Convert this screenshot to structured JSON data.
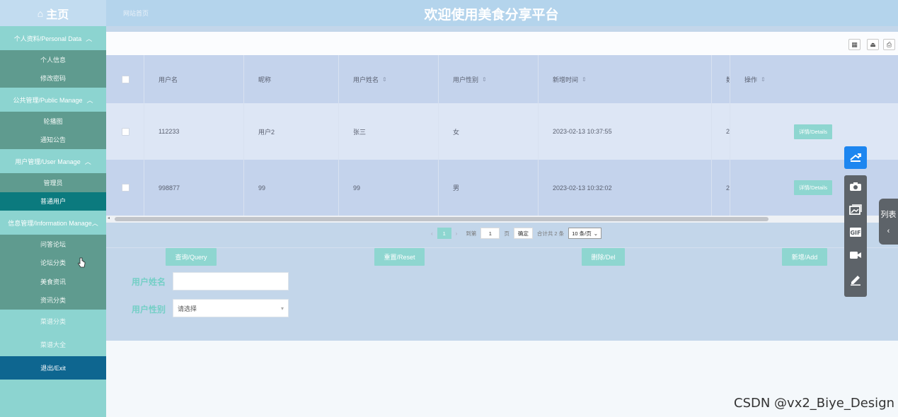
{
  "topbar": {
    "home_icon": "⌂",
    "home_label": "主页",
    "site_link": "网站首页",
    "title": "欢迎使用美食分享平台"
  },
  "sidebar": {
    "groups": [
      {
        "title": "个人资料/Personal Data",
        "items": [
          "个人信息",
          "修改密码"
        ]
      },
      {
        "title": "公共管理/Public Manage",
        "items": [
          "轮播图",
          "通知公告"
        ]
      },
      {
        "title": "用户管理/User Manage",
        "items": [
          "管理员",
          "普通用户"
        ]
      },
      {
        "title": "信息管理/Information Manage",
        "items": [
          "问答论坛",
          "论坛分类",
          "美食资讯",
          "资讯分类"
        ]
      }
    ],
    "singles": [
      "菜谱分类",
      "菜谱大全"
    ],
    "exit": "退出/Exit",
    "active_item": "普通用户"
  },
  "toolbar": {
    "icons": [
      "qr-icon",
      "export-icon",
      "print-icon"
    ]
  },
  "table": {
    "columns": [
      "用户名",
      "昵称",
      "用户姓名",
      "用户性别",
      "新增时间",
      "数",
      "操作"
    ],
    "rows": [
      {
        "username": "112233",
        "nickname": "用户2",
        "name": "张三",
        "gender": "女",
        "time": "2023-02-13 10:37:55",
        "extra": "2",
        "action": "详情/Details"
      },
      {
        "username": "998877",
        "nickname": "99",
        "name": "99",
        "gender": "男",
        "time": "2023-02-13 10:32:02",
        "extra": "2",
        "action": "详情/Details"
      }
    ]
  },
  "pager": {
    "prev": "‹",
    "current": "1",
    "next": "›",
    "goto_label": "到第",
    "goto_value": "1",
    "page_suffix": "页",
    "confirm": "确定",
    "total": "合计共 2 条",
    "page_size": "10 条/页"
  },
  "actions": {
    "query": "查询/Query",
    "reset": "重置/Reset",
    "delete": "删除/Del",
    "add": "新增/Add"
  },
  "form": {
    "name_label": "用户姓名",
    "name_value": "",
    "gender_label": "用户性别",
    "gender_placeholder": "请选择"
  },
  "side_tab": {
    "label": "列表",
    "arrow": "‹"
  },
  "watermark": "CSDN @vx2_Biye_Design",
  "colors": {
    "topbar": "#b4d4ec",
    "sidebar": "#8cd4d0",
    "sidebar_items": "#5f9b8f",
    "active": "#0b7a7e",
    "exit": "#0e6690",
    "button": "#8ed6d0",
    "float_active": "#1d86f0"
  }
}
